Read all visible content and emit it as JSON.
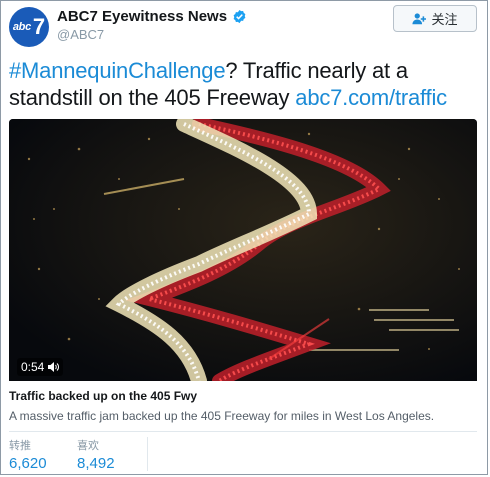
{
  "account": {
    "display_name": "ABC7 Eyewitness News",
    "handle": "@ABC7",
    "avatar_text": "abc",
    "avatar_num": "7",
    "verified_icon": "verified-badge-icon"
  },
  "follow": {
    "label": "关注",
    "icon": "add-user-icon"
  },
  "tweet": {
    "hashtag": "#MannequinChallenge",
    "text": "? Traffic nearly at a standstill on the 405 Freeway ",
    "link": "abc7.com/traffic"
  },
  "media": {
    "duration": "0:54",
    "title": "Traffic backed up on the 405 Fwy",
    "description": "A massive traffic jam backed up the 405 Freeway for miles in West Los Angeles."
  },
  "stats": {
    "retweets_label": "转推",
    "retweets": "6,620",
    "likes_label": "喜欢",
    "likes": "8,492"
  },
  "colors": {
    "link": "#1b8bd6",
    "brand": "#1a5bb8"
  }
}
